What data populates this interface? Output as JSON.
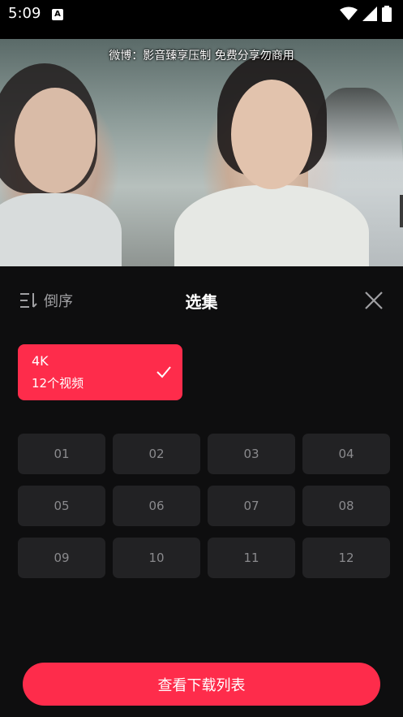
{
  "status_bar": {
    "time": "5:09",
    "notification_icon": "a-icon",
    "icons": [
      "wifi-icon",
      "signal-icon",
      "battery-icon"
    ]
  },
  "video": {
    "caption": "微博：影音臻享压制   免费分享勿商用"
  },
  "panel": {
    "sort_label": "倒序",
    "sort_icon": "sort-order-icon",
    "title": "选集",
    "close_icon": "close-icon"
  },
  "quality": {
    "label": "4K",
    "count": "12个视频",
    "selected": true,
    "icon": "check-icon"
  },
  "episodes": [
    "01",
    "02",
    "03",
    "04",
    "05",
    "06",
    "07",
    "08",
    "09",
    "10",
    "11",
    "12"
  ],
  "download_button": "查看下载列表",
  "colors": {
    "accent": "#fe2c4b",
    "panel_bg": "#0e0e0f",
    "episode_bg": "#222224",
    "episode_text": "#8a8a8d"
  }
}
